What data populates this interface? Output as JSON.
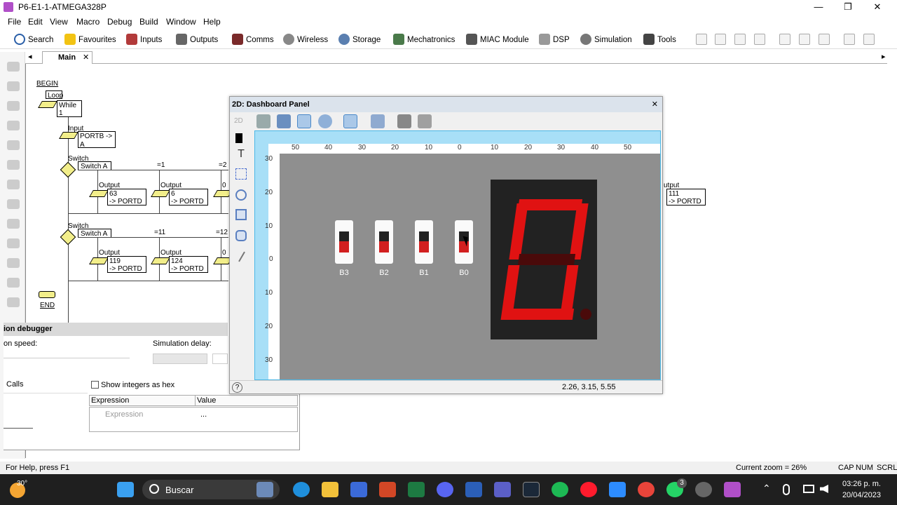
{
  "window": {
    "title": "P6-E1-1-ATMEGA328P",
    "min": "—",
    "max": "❐",
    "close": "✕"
  },
  "menu": [
    "File",
    "Edit",
    "View",
    "Macro",
    "Debug",
    "Build",
    "Window",
    "Help"
  ],
  "toolbar": [
    "Search",
    "Favourites",
    "Inputs",
    "Outputs",
    "Comms",
    "Wireless",
    "Storage",
    "Mechatronics",
    "MIAC Module",
    "DSP",
    "Simulation",
    "Tools"
  ],
  "tab": {
    "label": "Main",
    "close": "✕",
    "scroll_left": "◂",
    "scroll_right": "▸"
  },
  "flowchart": {
    "begin": "BEGIN",
    "loop": "Loop",
    "while": "While",
    "while_val": "1",
    "input_t": "Input",
    "input_body": "PORTB ->",
    "input_body2": "A",
    "switch1_t": "Switch",
    "switch1_body": "Switch A",
    "sw1_c1": "=1",
    "sw1_c2": "=2",
    "o1_t": "Output",
    "o1_b1": "63",
    "o1_b2": "-> PORTD",
    "o2_t": "Output",
    "o2_b1": "6",
    "o2_b2": "-> PORTD",
    "o3_t": "0",
    "switch2_t": "Switch",
    "switch2_body": "Switch A",
    "sw2_c1": "=11",
    "sw2_c2": "=12",
    "o4_t": "Output",
    "o4_b1": "119",
    "o4_b2": "-> PORTD",
    "o5_t": "Output",
    "o5_b1": "124",
    "o5_b2": "-> PORTD",
    "o6_t": "0",
    "right_t": "utput",
    "right_b1": "111",
    "right_b2": "-> PORTD",
    "end": "END"
  },
  "debugger": {
    "title": "ion debugger",
    "speed": "on speed:",
    "delay": "Simulation delay:",
    "calls": "Calls",
    "hex": "Show integers as hex",
    "col_expr": "Expression",
    "col_val": "Value",
    "row_expr": "Expression",
    "row_val": "..."
  },
  "dashboard": {
    "title": "2D: Dashboard Panel",
    "close": "✕",
    "h_ticks": [
      "50",
      "40",
      "30",
      "20",
      "10",
      "0",
      "10",
      "20",
      "30",
      "40",
      "50"
    ],
    "v_ticks": [
      "30",
      "20",
      "10",
      "0",
      "10",
      "20",
      "30"
    ],
    "switches": [
      {
        "label": "B3",
        "on": true
      },
      {
        "label": "B2",
        "on": true
      },
      {
        "label": "B1",
        "on": true
      },
      {
        "label": "B0",
        "on": true
      }
    ],
    "segment_color": "#e01212",
    "coords": "2.26, 3.15, 5.55",
    "help": "?"
  },
  "status": {
    "help": "For Help, press F1",
    "zoom": "Current zoom = 26%",
    "caps": "CAP",
    "num": "NUM",
    "scrl": "SCRL"
  },
  "taskbar": {
    "temp": "30°",
    "search": "Buscar",
    "time": "03:26 p. m.",
    "date": "20/04/2023",
    "badge": "3"
  }
}
